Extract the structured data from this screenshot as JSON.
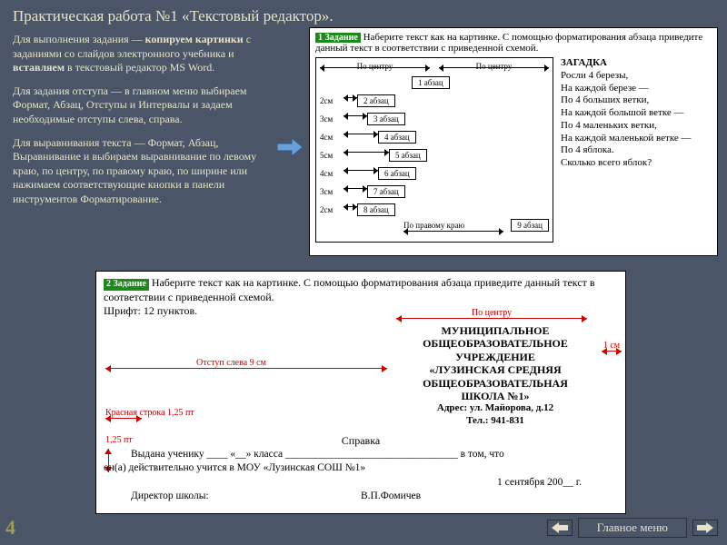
{
  "title": "Практическая работа №1 «Текстовый редактор».",
  "intro": {
    "p1_a": "Для выполнения задания — ",
    "p1_b": "копируем картинки",
    "p1_c": " с заданиями со слайдов электронного учебника и ",
    "p1_d": "вставляем",
    "p1_e": " в текстовый редактор MS Word.",
    "p2": "Для задания отступа — в главном меню выбираем Формат, Абзац, Отступы и Интервалы и задаем необходимые отступы слева, справа.",
    "p3": "Для выравнивания текста — Формат, Абзац, Выравнивание и выбираем выравнивание по левому краю, по центру, по правому краю, по ширине или нажимаем соответствующие кнопки в панели инструментов Форматирование."
  },
  "task1": {
    "label": "1 Задание",
    "text": "Наберите текст как на картинке. С помощью форматирования абзаца приведите данный текст в соответствии с приведенной схемой.",
    "header_left": "По центру",
    "header_right": "По центру",
    "rows": [
      {
        "margin": "",
        "indent": 75,
        "fill": 65,
        "para": "1 абзац"
      },
      {
        "margin": "2см",
        "indent": 15,
        "fill": 55,
        "para": "2 абзац"
      },
      {
        "margin": "3см",
        "indent": 26,
        "fill": 55,
        "para": "3 абзац"
      },
      {
        "margin": "4см",
        "indent": 38,
        "fill": 55,
        "para": "4 абзац"
      },
      {
        "margin": "5см",
        "indent": 50,
        "fill": 55,
        "para": "5 абзац"
      },
      {
        "margin": "4см",
        "indent": 38,
        "fill": 55,
        "para": "6 абзац"
      },
      {
        "margin": "3см",
        "indent": 26,
        "fill": 55,
        "para": "7 абзац"
      },
      {
        "margin": "2см",
        "indent": 15,
        "fill": 55,
        "para": "8 абзац"
      },
      {
        "margin": "",
        "indent": 0,
        "fill": 0,
        "para": "9 абзац"
      }
    ],
    "footer": "По правому краю"
  },
  "riddle": {
    "title": "ЗАГАДКА",
    "lines": [
      "Росли 4 березы,",
      "На каждой березе —",
      "По 4 больших ветки,",
      "На каждой большой ветке —",
      "По 4 маленьких ветки,",
      "На каждой маленькой ветке —",
      "По 4 яблока.",
      "Сколько всего яблок?"
    ]
  },
  "task2": {
    "label": "2 Задание",
    "text": "Наберите текст как на картинке. С помощью форматирования абзаца приведите данный текст в соответствии с приведенной схемой.",
    "font_note": "Шрифт: 12 пунктов.",
    "ann": {
      "center": "По центру",
      "left_indent": "Отступ слева 9 см",
      "right_margin": "1 см",
      "red_line": "Красная строка 1,25 пт",
      "spacing": "1,25 пт"
    },
    "school": [
      "МУНИЦИПАЛЬНОЕ",
      "ОБЩЕОБРАЗОВАТЕЛЬНОЕ",
      "УЧРЕЖДЕНИЕ",
      "«ЛУЗИНСКАЯ СРЕДНЯЯ",
      "ОБЩЕОБРАЗОВАТЕЛЬНАЯ",
      "ШКОЛА №1»"
    ],
    "addr": "Адрес: ул. Майорова, д.12",
    "tel": "Тел.: 941-831",
    "spravka_title": "Справка",
    "line1": "Выдана ученику ____ «__» класса _________________________________ в том, что",
    "line2": "он(а) действительно учится в МОУ «Лузинская СОШ №1»",
    "date": "1 сентября 200__ г.",
    "director_l": "Директор школы:",
    "director_r": "В.П.Фомичев"
  },
  "page_number": "4",
  "menu_label": "Главное меню"
}
